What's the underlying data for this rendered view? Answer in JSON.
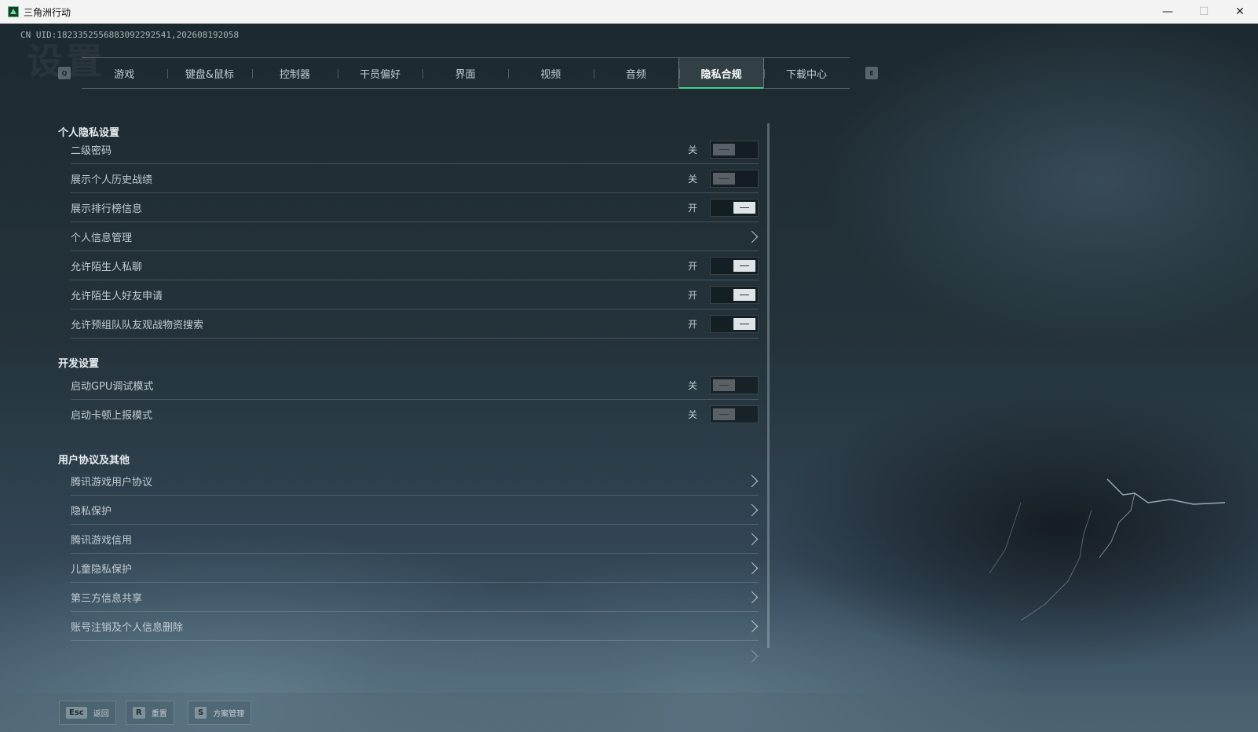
{
  "window": {
    "title": "三角洲行动",
    "min_glyph": "—",
    "max_glyph": "☐",
    "close_glyph": "✕"
  },
  "uid": "CN UID:1823352556883092292541,202608192058",
  "watermark": "设置",
  "tabs": {
    "left_key": "Q",
    "right_key": "E",
    "items": [
      "游戏",
      "键盘&鼠标",
      "控制器",
      "干员偏好",
      "界面",
      "视频",
      "音频",
      "隐私合规",
      "下载中心"
    ],
    "active": "隐私合规"
  },
  "sections": {
    "privacy": {
      "title": "个人隐私设置",
      "rows": [
        {
          "label": "二级密码",
          "state": "关"
        },
        {
          "label": "展示个人历史战绩",
          "state": "关"
        },
        {
          "label": "展示排行榜信息",
          "state": "开"
        },
        {
          "label": "个人信息管理"
        },
        {
          "label": "允许陌生人私聊",
          "state": "开"
        },
        {
          "label": "允许陌生人好友申请",
          "state": "开"
        },
        {
          "label": "允许预组队队友观战物资搜索",
          "state": "开"
        }
      ]
    },
    "dev": {
      "title": "开发设置",
      "rows": [
        {
          "label": "启动GPU调试模式",
          "state": "关"
        },
        {
          "label": "启动卡顿上报模式",
          "state": "关"
        }
      ]
    },
    "agreements": {
      "title": "用户协议及其他",
      "rows": [
        {
          "label": "腾讯游戏用户协议"
        },
        {
          "label": "隐私保护"
        },
        {
          "label": "腾讯游戏信用"
        },
        {
          "label": "儿童隐私保护"
        },
        {
          "label": "第三方信息共享"
        },
        {
          "label": "账号注销及个人信息删除"
        }
      ]
    }
  },
  "bottom": {
    "back": {
      "key": "Esc",
      "label": "返回"
    },
    "reset": {
      "key": "R",
      "label": "重置"
    },
    "scheme": {
      "key": "S",
      "label": "方案管理"
    }
  }
}
